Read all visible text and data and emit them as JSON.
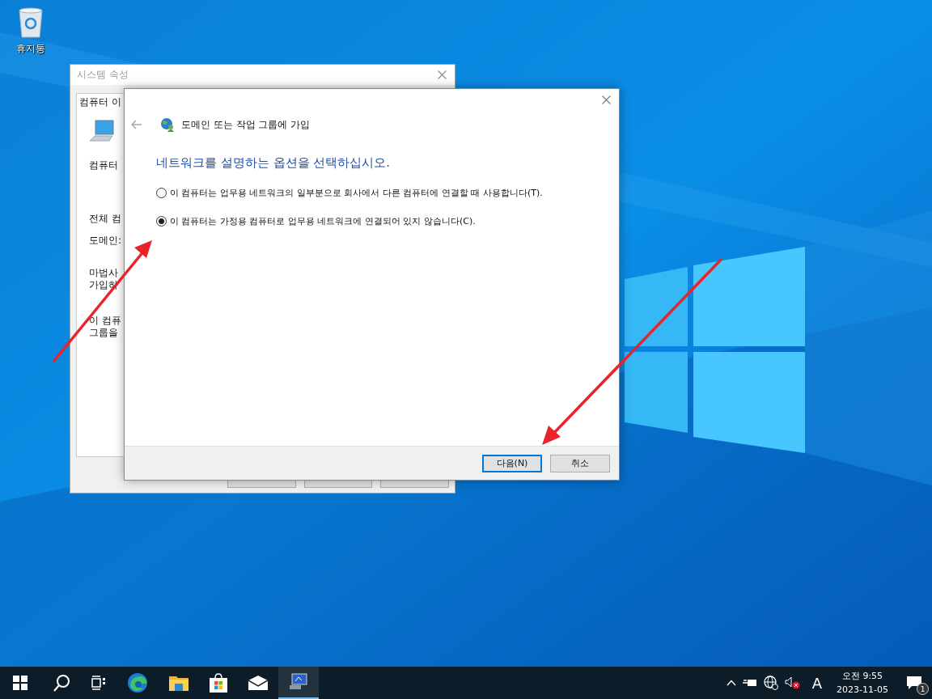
{
  "desktop": {
    "icons": [
      {
        "label": "휴지통"
      }
    ]
  },
  "background_window": {
    "title": "시스템 속성",
    "tab": "컴퓨터 이",
    "lines": [
      {
        "kind": "icon"
      },
      {
        "kind": "text",
        "text": "컴퓨터"
      },
      {
        "kind": "text",
        "text": "전체 컴"
      },
      {
        "kind": "text",
        "text": "도메인:"
      },
      {
        "kind": "pair",
        "text": "마법사",
        "text2": "가입하"
      },
      {
        "kind": "pair",
        "text": "이 컴퓨",
        "text2": "그룹을"
      }
    ]
  },
  "dialog": {
    "title": "도메인 또는 작업 그룹에 가입",
    "heading": "네트워크를 설명하는 옵션을 선택하십시오.",
    "options": [
      {
        "label": "이 컴퓨터는 업무용 네트워크의 일부분으로 회사에서 다른 컴퓨터에 연결할 때 사용합니다(T).",
        "selected": false
      },
      {
        "label": "이 컴퓨터는 가정용 컴퓨터로 업무용 네트워크에 연결되어 있지 않습니다(C).",
        "selected": true
      }
    ],
    "buttons": [
      {
        "label": "다음(N)",
        "default": true
      },
      {
        "label": "취소",
        "default": false
      }
    ]
  },
  "taskbar": {
    "time": "오전 9:55",
    "date": "2023-11-05",
    "input_indicator": "A",
    "notification_count": "1"
  }
}
